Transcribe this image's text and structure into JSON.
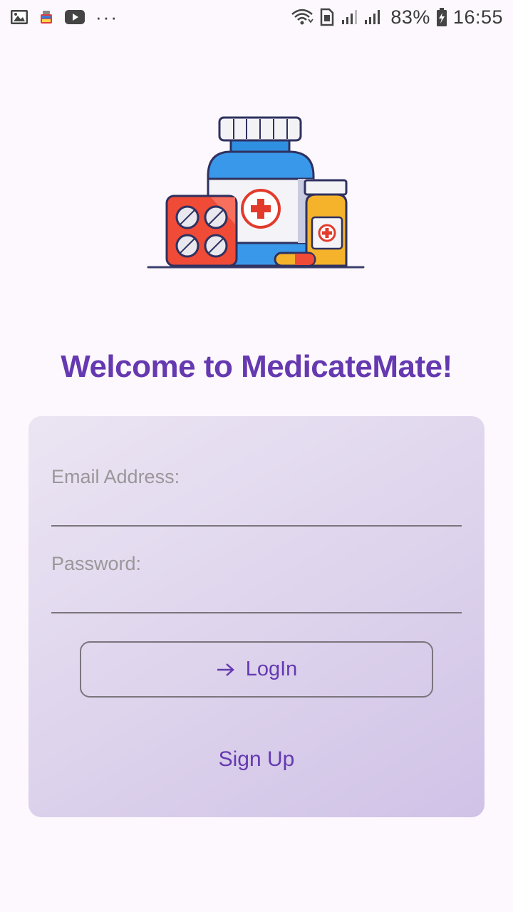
{
  "status_bar": {
    "icons_left": [
      "gallery-icon",
      "app-notification-icon",
      "youtube-icon",
      "more-dots-icon"
    ],
    "more_dots": "···",
    "battery_percent": "83%",
    "time": "16:55",
    "icons_right": [
      "wifi-icon",
      "sim-icon",
      "signal-icon",
      "battery-icon"
    ]
  },
  "hero": {
    "illustration": "medicine-bottles-illustration"
  },
  "welcome_title": "Welcome to MedicateMate!",
  "login_form": {
    "email_label": "Email Address:",
    "email_value": "",
    "password_label": "Password:",
    "password_value": "",
    "login_button_label": "LogIn",
    "signup_label": "Sign Up"
  },
  "colors": {
    "accent": "#6539b0",
    "background": "#fdf8fd",
    "card_gradient_start": "#ebe5f3",
    "card_gradient_end": "#d0c2e7"
  }
}
